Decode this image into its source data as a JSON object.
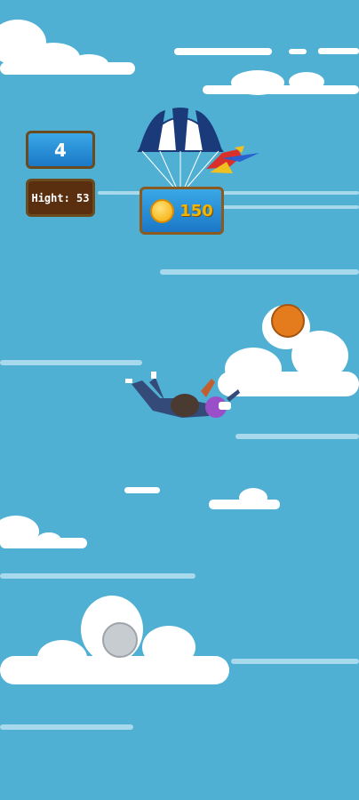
{
  "hud": {
    "level": "4",
    "high_score": "Hight: 53",
    "coins": "150"
  },
  "icons": [
    "parachute-icon",
    "parrot-icon",
    "coin-icon",
    "skydiver-icon",
    "orange-ball-icon",
    "grey-ball-icon"
  ],
  "colors": {
    "sky": "#4fb0d4",
    "hud_blue": "#1b78c7",
    "hud_brown": "#5a2f10",
    "coin_gold": "#f5a800",
    "ball_orange": "#e47b1d"
  }
}
